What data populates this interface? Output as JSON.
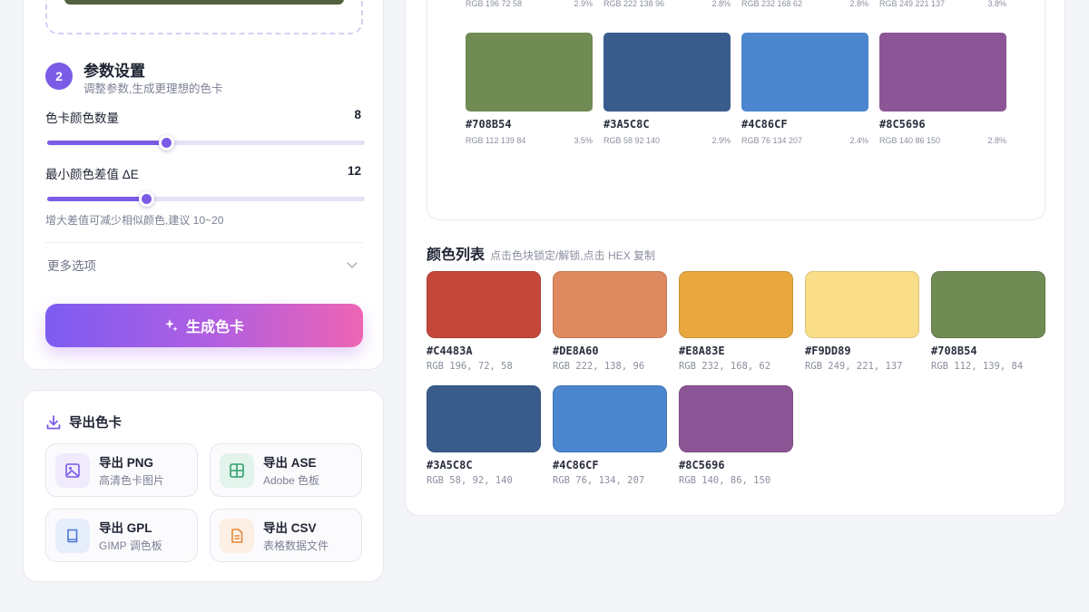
{
  "settings": {
    "step_number": "2",
    "title": "参数设置",
    "subtitle": "调整参数,生成更理想的色卡",
    "color_count_label": "色卡颜色数量",
    "color_count_value": "8",
    "color_count_fraction": 0.375,
    "min_delta_label": "最小颜色差值 ΔE",
    "min_delta_value": "12",
    "min_delta_fraction": 0.31,
    "hint": "增大差值可减少相似颜色,建议 10~20",
    "more_options": "更多选项",
    "generate_label": "生成色卡",
    "slider_color": "#7b5ce6"
  },
  "export": {
    "title": "导出色卡",
    "buttons": [
      {
        "name": "导出 PNG",
        "desc": "高清色卡图片",
        "icon": "image-icon",
        "bg": "#efeafc",
        "fg": "#7b5ce6"
      },
      {
        "name": "导出 ASE",
        "desc": "Adobe 色板",
        "icon": "grid-icon",
        "bg": "#e3f4ec",
        "fg": "#2f9e6a"
      },
      {
        "name": "导出 GPL",
        "desc": "GIMP 调色板",
        "icon": "book-icon",
        "bg": "#e6eefc",
        "fg": "#4a78d6"
      },
      {
        "name": "导出 CSV",
        "desc": "表格数据文件",
        "icon": "file-icon",
        "bg": "#fcefe3",
        "fg": "#e3893a"
      }
    ]
  },
  "preview": {
    "top_row": [
      {
        "rgb": "RGB 196 72 58",
        "pct": "2.9%"
      },
      {
        "rgb": "RGB 222 138 96",
        "pct": "2.8%"
      },
      {
        "rgb": "RGB 232 168 62",
        "pct": "2.8%"
      },
      {
        "rgb": "RGB 249 221 137",
        "pct": "3.8%"
      }
    ],
    "swatches": [
      {
        "hex": "#708B54",
        "rgb": "RGB 112 139 84",
        "pct": "3.5%"
      },
      {
        "hex": "#3A5C8C",
        "rgb": "RGB 58 92 140",
        "pct": "2.9%"
      },
      {
        "hex": "#4C86CF",
        "rgb": "RGB 76 134 207",
        "pct": "2.4%"
      },
      {
        "hex": "#8C5696",
        "rgb": "RGB 140 86 150",
        "pct": "2.8%"
      }
    ]
  },
  "color_list": {
    "title": "颜色列表",
    "subtitle": "点击色块锁定/解锁,点击 HEX 复制",
    "colors": [
      {
        "hex": "#C4483A",
        "rgb": "RGB 196, 72, 58"
      },
      {
        "hex": "#DE8A60",
        "rgb": "RGB 222, 138, 96"
      },
      {
        "hex": "#E8A83E",
        "rgb": "RGB 232, 168, 62"
      },
      {
        "hex": "#F9DD89",
        "rgb": "RGB 249, 221, 137"
      },
      {
        "hex": "#708B54",
        "rgb": "RGB 112, 139, 84"
      },
      {
        "hex": "#3A5C8C",
        "rgb": "RGB 58, 92, 140"
      },
      {
        "hex": "#4C86CF",
        "rgb": "RGB 76, 134, 207"
      },
      {
        "hex": "#8C5696",
        "rgb": "RGB 140, 86, 150"
      }
    ]
  }
}
